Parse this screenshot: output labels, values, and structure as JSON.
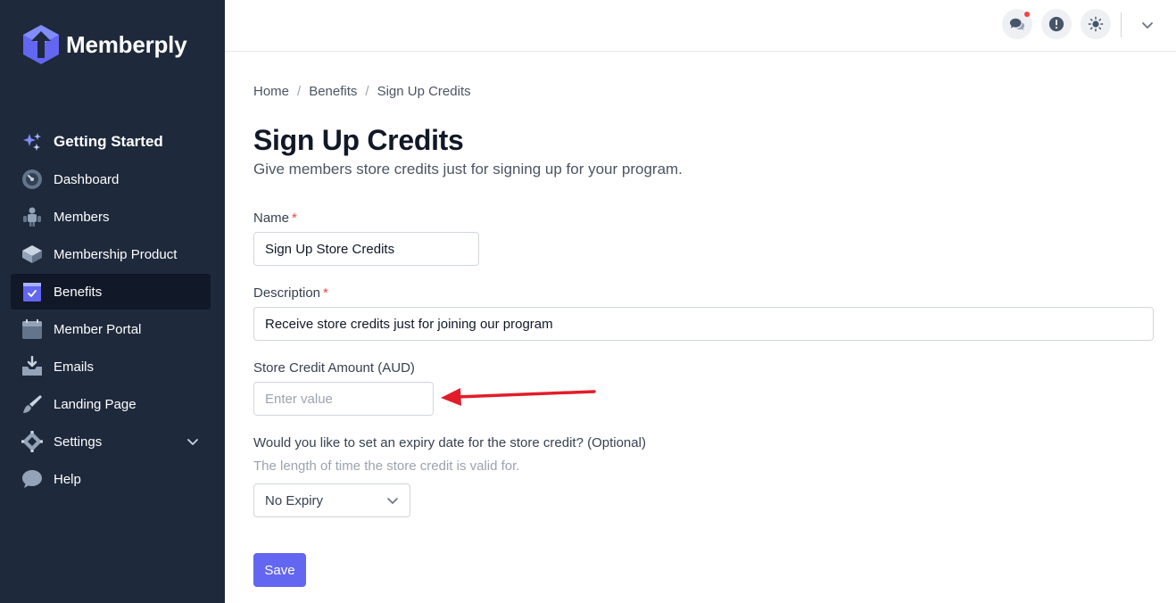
{
  "app": {
    "name": "Memberply",
    "brand_color": "#6366f1",
    "sidebar_bg": "#1e293b"
  },
  "sidebar": {
    "items": [
      {
        "label": "Getting Started",
        "icon": "sparkles-icon"
      },
      {
        "label": "Dashboard",
        "icon": "gauge-icon"
      },
      {
        "label": "Members",
        "icon": "users-icon"
      },
      {
        "label": "Membership Product",
        "icon": "cube-icon"
      },
      {
        "label": "Benefits",
        "icon": "clipboard-check-icon",
        "active": true
      },
      {
        "label": "Member Portal",
        "icon": "calendar-icon"
      },
      {
        "label": "Emails",
        "icon": "inbox-icon"
      },
      {
        "label": "Landing Page",
        "icon": "brush-icon"
      },
      {
        "label": "Settings",
        "icon": "settings-icon",
        "has_submenu": true
      },
      {
        "label": "Help",
        "icon": "chat-icon"
      }
    ]
  },
  "topbar": {
    "icons": [
      "chat-bubbles-icon",
      "alert-circle-icon",
      "sun-icon",
      "chevron-down-icon"
    ],
    "notification_color": "#ef4444"
  },
  "breadcrumb": {
    "items": [
      "Home",
      "Benefits",
      "Sign Up Credits"
    ],
    "separator": "/"
  },
  "page": {
    "title": "Sign Up Credits",
    "subtitle": "Give members store credits just for signing up for your program."
  },
  "form": {
    "name": {
      "label": "Name",
      "required_marker": "*",
      "value": "Sign Up Store Credits"
    },
    "description": {
      "label": "Description",
      "required_marker": "*",
      "value": "Receive store credits just for joining our program"
    },
    "amount": {
      "label": "Store Credit Amount (AUD)",
      "value": "",
      "placeholder": "Enter value"
    },
    "expiry": {
      "label": "Would you like to set an expiry date for the store credit? (Optional)",
      "help": "The length of time the store credit is valid for.",
      "selected": "No Expiry"
    },
    "save_label": "Save"
  },
  "annotation": {
    "arrow_color": "#e11d2a"
  }
}
